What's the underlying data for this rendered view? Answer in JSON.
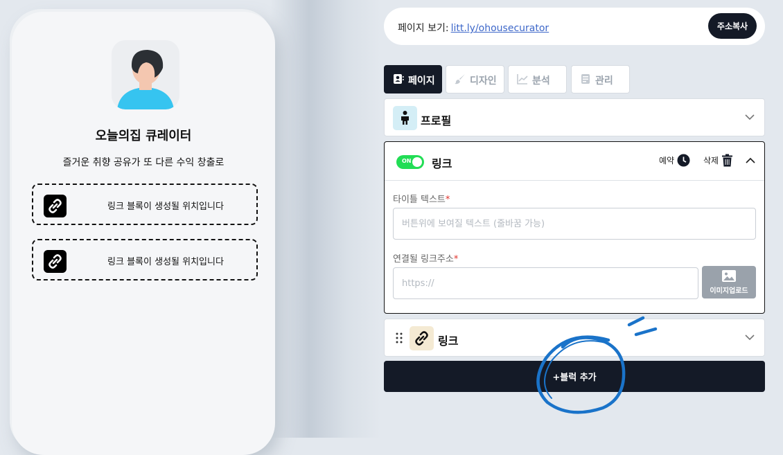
{
  "preview": {
    "profile_name": "오늘의집 큐레이터",
    "profile_bio": "즐거운 취향 공유가 또 다른 수익 창출로",
    "link_placeholders": [
      {
        "label": "링크 블록이 생성될 위치입니다",
        "icon": "link-icon"
      },
      {
        "label": "링크 블록이 생성될 위치입니다",
        "icon": "link-icon"
      }
    ]
  },
  "urlbar": {
    "label": "페이지 보기:",
    "url": "litt.ly/ohousecurator",
    "copy_label": "주소복사"
  },
  "tabs": [
    {
      "label": "페이지",
      "icon": "page-icon",
      "active": true
    },
    {
      "label": "디자인",
      "icon": "brush-icon",
      "active": false
    },
    {
      "label": "분석",
      "icon": "chart-icon",
      "active": false
    },
    {
      "label": "관리",
      "icon": "manage-icon",
      "active": false
    }
  ],
  "sections": {
    "profile": {
      "title": "프로필",
      "icon": "person-icon"
    },
    "link_open": {
      "toggle_label": "ON",
      "title": "링크",
      "schedule_label": "예약",
      "delete_label": "삭제",
      "title_field": {
        "label": "타이틀 텍스트",
        "required": "*",
        "placeholder": "버튼위에 보여질 텍스트 (줄바꿈 가능)"
      },
      "url_field": {
        "label": "연결될 링크주소",
        "required": "*",
        "placeholder": "https://"
      },
      "image_upload_label": "이미지업로드"
    },
    "link_collapsed": {
      "title": "링크",
      "icon": "link-icon"
    }
  },
  "add_block_label": "+블럭 추가",
  "colors": {
    "dark": "#141a27",
    "toggle_on": "#22dd55",
    "link": "#3d67c9",
    "annotation": "#1a73c9"
  }
}
